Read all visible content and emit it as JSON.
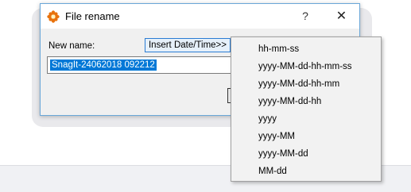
{
  "dialog": {
    "title": "File rename",
    "help_label": "?",
    "close_label": "✕",
    "new_name_label": "New name:",
    "insert_button_label": "Insert Date/Time>>",
    "name_value": "SnagIt-24062018 092212"
  },
  "menu": {
    "items": [
      "hh-mm-ss",
      "yyyy-MM-dd-hh-mm-ss",
      "yyyy-MM-dd-hh-mm",
      "yyyy-MM-dd-hh",
      "yyyy",
      "yyyy-MM",
      "yyyy-MM-dd",
      "MM-dd"
    ]
  },
  "colors": {
    "selection": "#0078d7",
    "focus_border": "#2b7cd3",
    "app_icon": "#e8720c"
  },
  "icons": {
    "app": "xnview-flower-icon",
    "close": "close-icon"
  }
}
